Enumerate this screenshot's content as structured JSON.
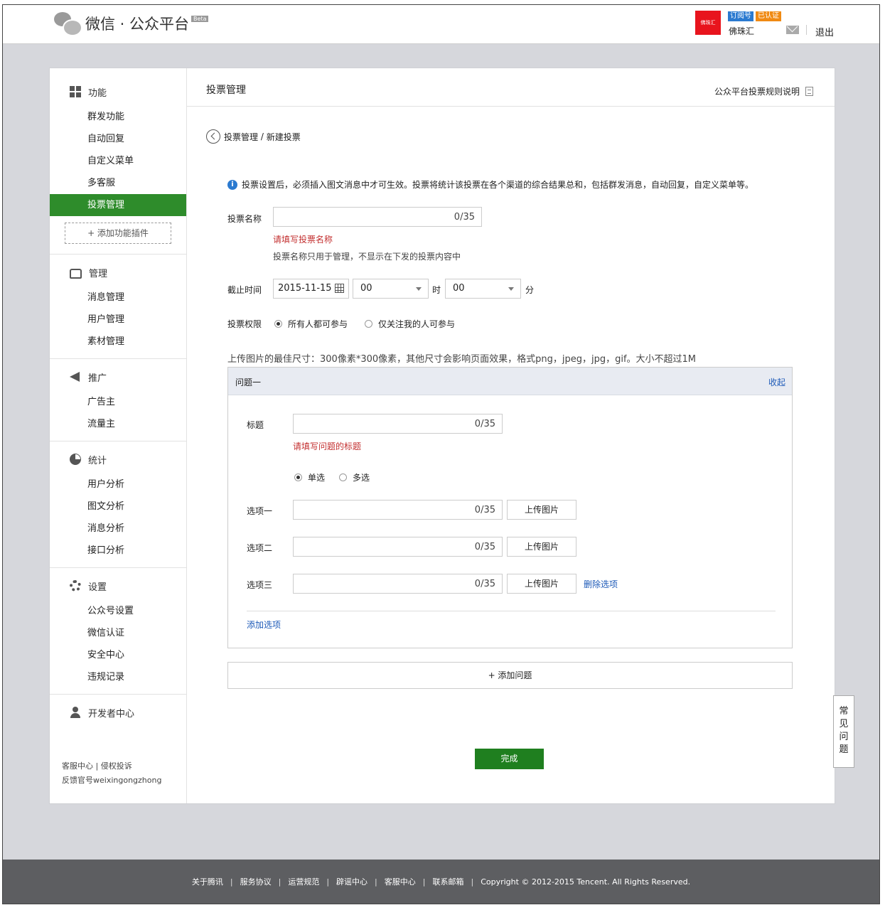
{
  "header": {
    "logo_text": "微信 · 公众平台",
    "beta": "Beta",
    "avatar_text": "佛珠汇",
    "badge_subscription": "订阅号",
    "badge_verified": "已认证",
    "account_name": "佛珠汇",
    "logout": "退出"
  },
  "sidebar": {
    "sections": [
      {
        "title": "功能",
        "items": [
          "群发功能",
          "自动回复",
          "自定义菜单",
          "多客服",
          "投票管理"
        ]
      },
      {
        "title": "管理",
        "items": [
          "消息管理",
          "用户管理",
          "素材管理"
        ]
      },
      {
        "title": "推广",
        "items": [
          "广告主",
          "流量主"
        ]
      },
      {
        "title": "统计",
        "items": [
          "用户分析",
          "图文分析",
          "消息分析",
          "接口分析"
        ]
      },
      {
        "title": "设置",
        "items": [
          "公众号设置",
          "微信认证",
          "安全中心",
          "违规记录"
        ]
      },
      {
        "title": "开发者中心",
        "items": []
      }
    ],
    "active_item": "投票管理",
    "add_plugin": "+ 添加功能插件",
    "footer_line1": "客服中心 | 侵权投诉",
    "footer_line2": "反馈官号weixingongzhong"
  },
  "main": {
    "title": "投票管理",
    "rules_link": "公众平台投票规则说明",
    "breadcrumb_parent": "投票管理",
    "breadcrumb_sep": " / ",
    "breadcrumb_current": "新建投票",
    "notice": "投票设置后，必须插入图文消息中才可生效。投票将统计该投票在各个渠道的综合结果总和，包括群发消息，自动回复，自定义菜单等。",
    "name_label": "投票名称",
    "name_count": "0/35",
    "name_error": "请填写投票名称",
    "name_hint": "投票名称只用于管理，不显示在下发的投票内容中",
    "deadline_label": "截止时间",
    "deadline_date": "2015-11-15",
    "deadline_hour": "00",
    "hour_unit": "时",
    "deadline_minute": "00",
    "minute_unit": "分",
    "perm_label": "投票权限",
    "perm_all": "所有人都可参与",
    "perm_followers": "仅关注我的人可参与",
    "upload_hint": "上传图片的最佳尺寸：300像素*300像素，其他尺寸会影响页面效果，格式png，jpeg，jpg，gif。大小不超过1M",
    "question": {
      "header": "问题一",
      "collapse": "收起",
      "title_label": "标题",
      "title_count": "0/35",
      "title_error": "请填写问题的标题",
      "single": "单选",
      "multi": "多选",
      "options": [
        {
          "label": "选项一",
          "count": "0/35",
          "upload": "上传图片"
        },
        {
          "label": "选项二",
          "count": "0/35",
          "upload": "上传图片"
        },
        {
          "label": "选项三",
          "count": "0/35",
          "upload": "上传图片"
        }
      ],
      "delete_option": "删除选项",
      "add_option": "添加选项"
    },
    "add_question": "+ 添加问题",
    "done": "完成"
  },
  "faq": [
    "常",
    "见",
    "问",
    "题"
  ],
  "footer": {
    "links": [
      "关于腾讯",
      "服务协议",
      "运营规范",
      "辟谣中心",
      "客服中心",
      "联系邮箱"
    ],
    "copyright": "Copyright © 2012-2015 Tencent. All Rights Reserved."
  }
}
